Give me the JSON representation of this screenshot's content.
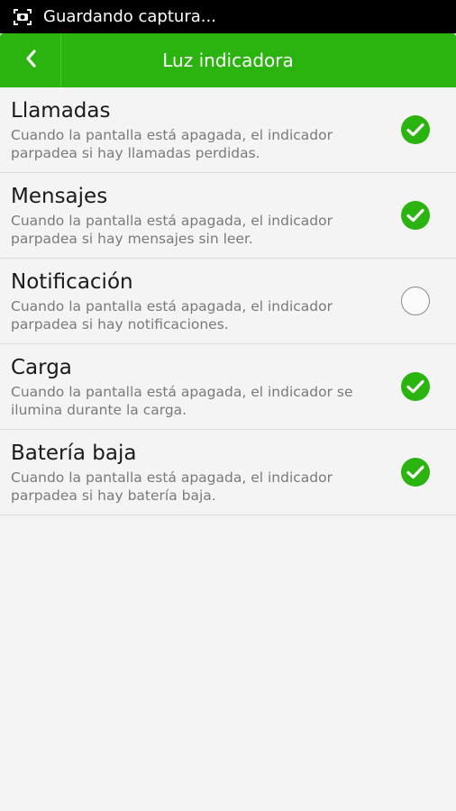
{
  "status_bar": {
    "text": "Guardando captura..."
  },
  "app_bar": {
    "title": "Luz indicadora"
  },
  "colors": {
    "accent": "#2bb30f"
  },
  "items": [
    {
      "title": "Llamadas",
      "description": "Cuando la pantalla está apagada, el indicador parpadea si hay llamadas perdidas.",
      "checked": true
    },
    {
      "title": "Mensajes",
      "description": "Cuando la pantalla está apagada, el indicador parpadea si hay mensajes sin leer.",
      "checked": true
    },
    {
      "title": "Notificación",
      "description": "Cuando la pantalla está apagada, el indicador parpadea si hay notificaciones.",
      "checked": false
    },
    {
      "title": "Carga",
      "description": "Cuando la pantalla está apagada, el indicador se ilumina durante la carga.",
      "checked": true
    },
    {
      "title": "Batería baja",
      "description": "Cuando la pantalla está apagada, el indicador parpadea si hay batería baja.",
      "checked": true
    }
  ]
}
